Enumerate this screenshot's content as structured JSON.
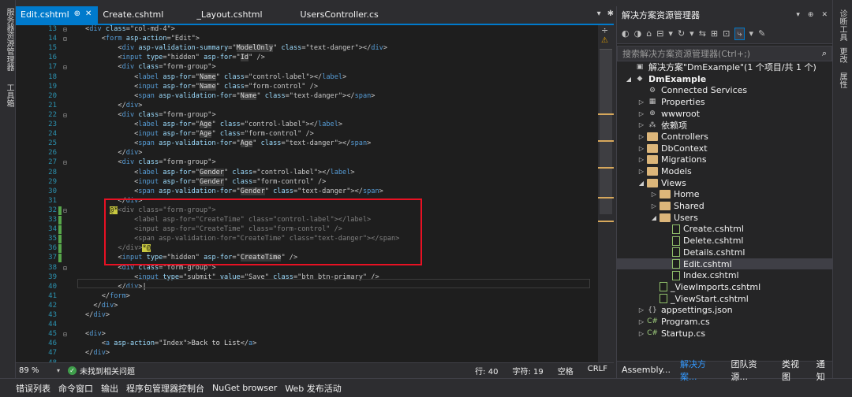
{
  "left_strip": [
    "服务器资源管理器",
    "工具箱"
  ],
  "right_strip": [
    "诊断工具",
    "更改",
    "属性"
  ],
  "editor_tabs": [
    {
      "label": "Edit.cshtml",
      "active": true
    },
    {
      "label": "Create.cshtml"
    },
    {
      "label": "_Layout.cshtml"
    },
    {
      "label": "UsersController.cs"
    }
  ],
  "editor_tab_controls": {
    "dropdown": "▾",
    "settings": "✱"
  },
  "scroll_icons": {
    "split": "÷",
    "warning": "⚠"
  },
  "status_bar": {
    "zoom": "89 %",
    "issues": "未找到相关问题",
    "line": "行: 40",
    "char": "字符: 19",
    "spaces": "空格",
    "eol": "CRLF"
  },
  "bottom_tabs": [
    "错误列表",
    "命令窗口",
    "输出",
    "程序包管理器控制台",
    "NuGet browser",
    "Web 发布活动"
  ],
  "solution_explorer": {
    "title": "解决方案资源管理器",
    "title_controls": {
      "dropdown": "▾",
      "pin": "⊕",
      "close": "✕"
    },
    "toolbar": [
      "◐",
      "◑",
      "⌂",
      "⊟",
      "▾",
      "↻",
      "▾",
      "⇆",
      "⊞",
      "⊡",
      "⤷",
      "▾",
      "✎"
    ],
    "search_placeholder": "搜索解决方案资源管理器(Ctrl+;)",
    "search_icon": "⌕",
    "tree": [
      {
        "label": "解决方案\"DmExample\"(1 个项目/共 1 个)",
        "level": 0,
        "arrow": "",
        "icon": "solution-icon",
        "glyph": "▣"
      },
      {
        "label": "DmExample",
        "level": 0,
        "arrow": "◢",
        "icon": "project-icon",
        "glyph": "◆",
        "bold": true
      },
      {
        "label": "Connected Services",
        "level": 1,
        "arrow": "",
        "icon": "connected-services-icon",
        "glyph": "⚙"
      },
      {
        "label": "Properties",
        "level": 1,
        "arrow": "▷",
        "icon": "properties-icon",
        "glyph": "▦"
      },
      {
        "label": "wwwroot",
        "level": 1,
        "arrow": "▷",
        "icon": "globe-icon",
        "glyph": "⊕"
      },
      {
        "label": "依赖项",
        "level": 1,
        "arrow": "▷",
        "icon": "dependencies-icon",
        "glyph": "⁂"
      },
      {
        "label": "Controllers",
        "level": 1,
        "arrow": "▷",
        "icon": "folder-icon",
        "folder": true
      },
      {
        "label": "DbContext",
        "level": 1,
        "arrow": "▷",
        "icon": "folder-icon",
        "folder": true
      },
      {
        "label": "Migrations",
        "level": 1,
        "arrow": "▷",
        "icon": "folder-icon",
        "folder": true
      },
      {
        "label": "Models",
        "level": 1,
        "arrow": "▷",
        "icon": "folder-icon",
        "folder": true
      },
      {
        "label": "Views",
        "level": 1,
        "arrow": "◢",
        "icon": "folder-icon",
        "folder": true
      },
      {
        "label": "Home",
        "level": 2,
        "arrow": "▷",
        "icon": "folder-icon",
        "folder": true
      },
      {
        "label": "Shared",
        "level": 2,
        "arrow": "▷",
        "icon": "folder-icon",
        "folder": true
      },
      {
        "label": "Users",
        "level": 2,
        "arrow": "◢",
        "icon": "folder-icon",
        "folder": true
      },
      {
        "label": "Create.cshtml",
        "level": 3,
        "arrow": "",
        "icon": "razor-file-icon",
        "file": true
      },
      {
        "label": "Delete.cshtml",
        "level": 3,
        "arrow": "",
        "icon": "razor-file-icon",
        "file": true
      },
      {
        "label": "Details.cshtml",
        "level": 3,
        "arrow": "",
        "icon": "razor-file-icon",
        "file": true
      },
      {
        "label": "Edit.cshtml",
        "level": 3,
        "arrow": "",
        "icon": "razor-file-icon",
        "file": true,
        "selected": true
      },
      {
        "label": "Index.cshtml",
        "level": 3,
        "arrow": "",
        "icon": "razor-file-icon",
        "file": true
      },
      {
        "label": "_ViewImports.cshtml",
        "level": 2,
        "arrow": "",
        "icon": "razor-file-icon",
        "file": true
      },
      {
        "label": "_ViewStart.cshtml",
        "level": 2,
        "arrow": "",
        "icon": "razor-file-icon",
        "file": true
      },
      {
        "label": "appsettings.json",
        "level": 1,
        "arrow": "▷",
        "icon": "json-file-icon",
        "glyph": "{}"
      },
      {
        "label": "Program.cs",
        "level": 1,
        "arrow": "▷",
        "icon": "csharp-file-icon",
        "glyph": "C#"
      },
      {
        "label": "Startup.cs",
        "level": 1,
        "arrow": "▷",
        "icon": "csharp-file-icon",
        "glyph": "C#"
      }
    ],
    "bottom_tabs": [
      {
        "label": "Assembly..."
      },
      {
        "label": "解决方案...",
        "active": true
      },
      {
        "label": "团队资源..."
      },
      {
        "label": "类视图"
      },
      {
        "label": "通知"
      }
    ]
  },
  "code_lines": [
    {
      "n": "13",
      "fold": "⊟",
      "html": "<span class='s'>&lt;</span><span class='t'>div</span> <span class='a'>class</span><span class='s'>=\"col-md-4\"&gt;</span>"
    },
    {
      "n": "14",
      "fold": "⊟",
      "html": "    <span class='s'>&lt;</span><span class='t'>form</span> <span class='a'>asp-action</span><span class='s'>=\"Edit\"&gt;</span>"
    },
    {
      "n": "15",
      "fold": "",
      "html": "        <span class='s'>&lt;</span><span class='t'>div</span> <span class='a'>asp-validation-summary</span><span class='s'>=\"</span><span class='hi'>ModelOnly</span><span class='s'>\"</span> <span class='a'>class</span><span class='s'>=\"text-danger\"&gt;&lt;/</span><span class='t'>div</span><span class='s'>&gt;</span>"
    },
    {
      "n": "16",
      "fold": "",
      "html": "        <span class='s'>&lt;</span><span class='t'>input</span> <span class='a'>type</span><span class='s'>=\"hidden\"</span> <span class='a'>asp-for</span><span class='s'>=\"</span><span class='hi'>Id</span><span class='s'>\" /&gt;</span>"
    },
    {
      "n": "17",
      "fold": "⊟",
      "html": "        <span class='s'>&lt;</span><span class='t'>div</span> <span class='a'>class</span><span class='s'>=\"form-group\"&gt;</span>"
    },
    {
      "n": "18",
      "fold": "",
      "html": "            <span class='s'>&lt;</span><span class='t'>label</span> <span class='a'>asp-for</span><span class='s'>=\"</span><span class='hi'>Name</span><span class='s'>\"</span> <span class='a'>class</span><span class='s'>=\"control-label\"&gt;&lt;/</span><span class='t'>label</span><span class='s'>&gt;</span>"
    },
    {
      "n": "19",
      "fold": "",
      "html": "            <span class='s'>&lt;</span><span class='t'>input</span> <span class='a'>asp-for</span><span class='s'>=\"</span><span class='hi'>Name</span><span class='s'>\"</span> <span class='a'>class</span><span class='s'>=\"form-control\" /&gt;</span>"
    },
    {
      "n": "20",
      "fold": "",
      "html": "            <span class='s'>&lt;</span><span class='t'>span</span> <span class='a'>asp-validation-for</span><span class='s'>=\"</span><span class='hi'>Name</span><span class='s'>\"</span> <span class='a'>class</span><span class='s'>=\"text-danger\"&gt;&lt;/</span><span class='t'>span</span><span class='s'>&gt;</span>"
    },
    {
      "n": "21",
      "fold": "",
      "html": "        <span class='s'>&lt;/</span><span class='t'>div</span><span class='s'>&gt;</span>"
    },
    {
      "n": "22",
      "fold": "⊟",
      "html": "        <span class='s'>&lt;</span><span class='t'>div</span> <span class='a'>class</span><span class='s'>=\"form-group\"&gt;</span>"
    },
    {
      "n": "23",
      "fold": "",
      "html": "            <span class='s'>&lt;</span><span class='t'>label</span> <span class='a'>asp-for</span><span class='s'>=\"</span><span class='hi'>Age</span><span class='s'>\"</span> <span class='a'>class</span><span class='s'>=\"control-label\"&gt;&lt;/</span><span class='t'>label</span><span class='s'>&gt;</span>"
    },
    {
      "n": "24",
      "fold": "",
      "html": "            <span class='s'>&lt;</span><span class='t'>input</span> <span class='a'>asp-for</span><span class='s'>=\"</span><span class='hi'>Age</span><span class='s'>\"</span> <span class='a'>class</span><span class='s'>=\"form-control\" /&gt;</span>"
    },
    {
      "n": "25",
      "fold": "",
      "html": "            <span class='s'>&lt;</span><span class='t'>span</span> <span class='a'>asp-validation-for</span><span class='s'>=\"</span><span class='hi'>Age</span><span class='s'>\"</span> <span class='a'>class</span><span class='s'>=\"text-danger\"&gt;&lt;/</span><span class='t'>span</span><span class='s'>&gt;</span>"
    },
    {
      "n": "26",
      "fold": "",
      "html": "        <span class='s'>&lt;/</span><span class='t'>div</span><span class='s'>&gt;</span>"
    },
    {
      "n": "27",
      "fold": "⊟",
      "html": "        <span class='s'>&lt;</span><span class='t'>div</span> <span class='a'>class</span><span class='s'>=\"form-group\"&gt;</span>"
    },
    {
      "n": "28",
      "fold": "",
      "html": "            <span class='s'>&lt;</span><span class='t'>label</span> <span class='a'>asp-for</span><span class='s'>=\"</span><span class='hi'>Gender</span><span class='s'>\"</span> <span class='a'>class</span><span class='s'>=\"control-label\"&gt;&lt;/</span><span class='t'>label</span><span class='s'>&gt;</span>"
    },
    {
      "n": "29",
      "fold": "",
      "html": "            <span class='s'>&lt;</span><span class='t'>input</span> <span class='a'>asp-for</span><span class='s'>=\"</span><span class='hi'>Gender</span><span class='s'>\"</span> <span class='a'>class</span><span class='s'>=\"form-control\" /&gt;</span>"
    },
    {
      "n": "30",
      "fold": "",
      "html": "            <span class='s'>&lt;</span><span class='t'>span</span> <span class='a'>asp-validation-for</span><span class='s'>=\"</span><span class='hi'>Gender</span><span class='s'>\"</span> <span class='a'>class</span><span class='s'>=\"text-danger\"&gt;&lt;/</span><span class='t'>span</span><span class='s'>&gt;</span>"
    },
    {
      "n": "31",
      "fold": "",
      "html": "        <span class='s'>&lt;/</span><span class='t'>div</span><span class='s'>&gt;</span>"
    },
    {
      "n": "32",
      "fold": "⊟",
      "bar": true,
      "html": "      <span class='bkt'>@*</span><span class='g'>&lt;div class=\"form-group\"&gt;</span>"
    },
    {
      "n": "33",
      "fold": "",
      "bar": true,
      "html": "            <span class='g'>&lt;label asp-for=\"CreateTime\" class=\"control-label\"&gt;&lt;/label&gt;</span>"
    },
    {
      "n": "34",
      "fold": "",
      "bar": true,
      "html": "            <span class='g'>&lt;input asp-for=\"CreateTime\" class=\"form-control\" /&gt;</span>"
    },
    {
      "n": "35",
      "fold": "",
      "bar": true,
      "html": "            <span class='g'>&lt;span asp-validation-for=\"CreateTime\" class=\"text-danger\"&gt;&lt;/span&gt;</span>"
    },
    {
      "n": "36",
      "fold": "",
      "bar": true,
      "html": "        <span class='g'>&lt;/div&gt;</span><span class='bkt'>*@</span>"
    },
    {
      "n": "37",
      "fold": "",
      "bar": true,
      "html": "        <span class='s'>&lt;</span><span class='t'>input</span> <span class='a'>type</span><span class='s'>=\"hidden\"</span> <span class='a'>asp-for</span><span class='s'>=\"</span><span class='hi'>CreateTime</span><span class='s'>\" /&gt;</span>"
    },
    {
      "n": "38",
      "fold": "⊟",
      "html": "        <span class='s'>&lt;</span><span class='t'>div</span> <span class='a'>class</span><span class='s'>=\"form-group\"&gt;</span>"
    },
    {
      "n": "39",
      "fold": "",
      "html": "            <span class='s'>&lt;</span><span class='t'>input</span> <span class='a'>type</span><span class='s'>=\"submit\"</span> <span class='a'>value</span><span class='s'>=\"Save\"</span> <span class='a'>class</span><span class='s'>=\"btn btn-primary\" /&gt;</span>"
    },
    {
      "n": "40",
      "fold": "",
      "html": "        <span class='s'>&lt;/</span><span class='t'>div</span><span class='s'>&gt;</span><span class='w'>|</span>"
    },
    {
      "n": "41",
      "fold": "",
      "html": "    <span class='s'>&lt;/</span><span class='t'>form</span><span class='s'>&gt;</span>"
    },
    {
      "n": "42",
      "fold": "",
      "html": "  <span class='s'>&lt;/</span><span class='t'>div</span><span class='s'>&gt;</span>"
    },
    {
      "n": "43",
      "fold": "",
      "html": "<span class='s'>&lt;/</span><span class='t'>div</span><span class='s'>&gt;</span>"
    },
    {
      "n": "44",
      "fold": "",
      "html": ""
    },
    {
      "n": "45",
      "fold": "⊟",
      "html": "<span class='s'>&lt;</span><span class='t'>div</span><span class='s'>&gt;</span>"
    },
    {
      "n": "46",
      "fold": "",
      "html": "    <span class='s'>&lt;</span><span class='t'>a</span> <span class='a'>asp-action</span><span class='s'>=\"Index\"&gt;</span>Back to List<span class='s'>&lt;/</span><span class='t'>a</span><span class='s'>&gt;</span>"
    },
    {
      "n": "47",
      "fold": "",
      "html": "<span class='s'>&lt;/</span><span class='t'>div</span><span class='s'>&gt;</span>"
    },
    {
      "n": "48",
      "fold": "",
      "html": ""
    }
  ]
}
